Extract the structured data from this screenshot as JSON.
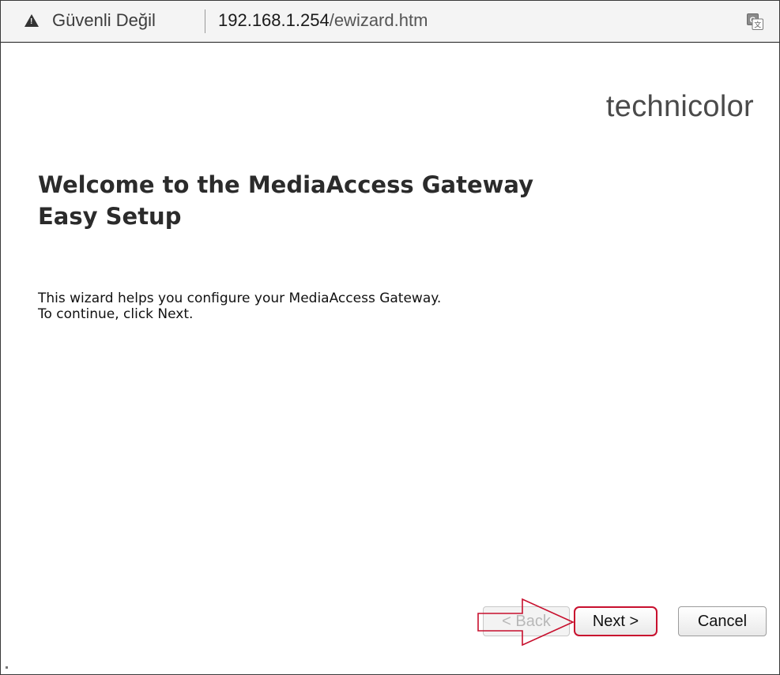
{
  "browser": {
    "security_label": "Güvenli Değil",
    "url_host": "192.168.1.254",
    "url_path": "/ewizard.htm",
    "warning_icon": "warning-triangle-icon",
    "translate_icon": "translate-icon"
  },
  "page": {
    "brand": "technicolor",
    "title_line1": "Welcome to the MediaAccess Gateway",
    "title_line2": "Easy Setup",
    "desc_line1": "This wizard helps you configure your MediaAccess Gateway.",
    "desc_line2": "To continue, click Next."
  },
  "buttons": {
    "back_label": "< Back",
    "next_label": "Next >",
    "cancel_label": "Cancel"
  },
  "colors": {
    "annotation_red": "#c8102e",
    "title_text": "#2b2b2b"
  }
}
